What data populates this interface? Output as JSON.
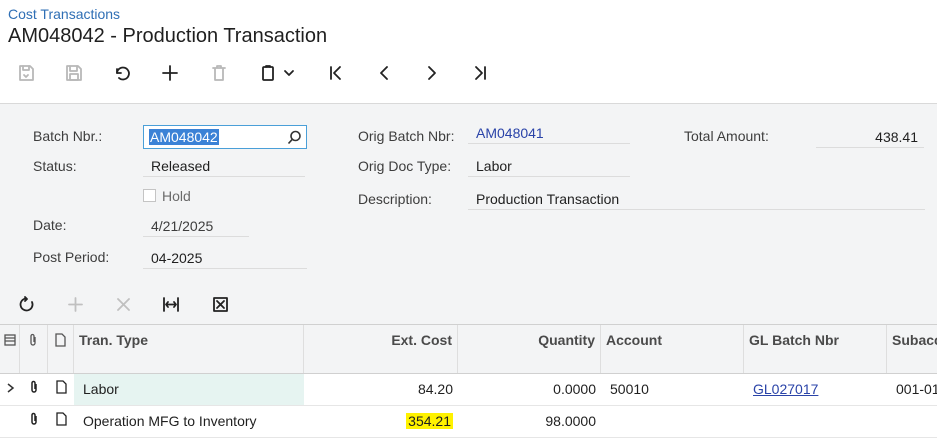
{
  "breadcrumb": "Cost Transactions",
  "title": "AM048042 - Production Transaction",
  "form": {
    "batch_nbr_label": "Batch Nbr.:",
    "batch_nbr_value": "AM048042",
    "status_label": "Status:",
    "status_value": "Released",
    "hold_label": "Hold",
    "date_label": "Date:",
    "date_value": "4/21/2025",
    "post_period_label": "Post Period:",
    "post_period_value": "04-2025",
    "orig_batch_label": "Orig Batch Nbr:",
    "orig_batch_value": "AM048041",
    "orig_doc_type_label": "Orig Doc Type:",
    "orig_doc_type_value": "Labor",
    "description_label": "Description:",
    "description_value": "Production Transaction",
    "total_amount_label": "Total Amount:",
    "total_amount_value": "438.41"
  },
  "grid": {
    "columns": [
      "Tran. Type",
      "Ext. Cost",
      "Quantity",
      "Account",
      "GL Batch Nbr",
      "Subacc"
    ],
    "rows": [
      {
        "tran_type": "Labor",
        "ext_cost": "84.20",
        "quantity": "0.0000",
        "account": "50010",
        "gl_batch": "GL027017",
        "subaccount": "001-01"
      },
      {
        "tran_type": "Operation MFG to Inventory",
        "ext_cost": "354.21",
        "quantity": "98.0000",
        "account": "",
        "gl_batch": "",
        "subaccount": ""
      }
    ]
  },
  "colors": {
    "link": "#2a43a8",
    "highlight": "#fff200",
    "selected_row": "#e6f4f1"
  }
}
